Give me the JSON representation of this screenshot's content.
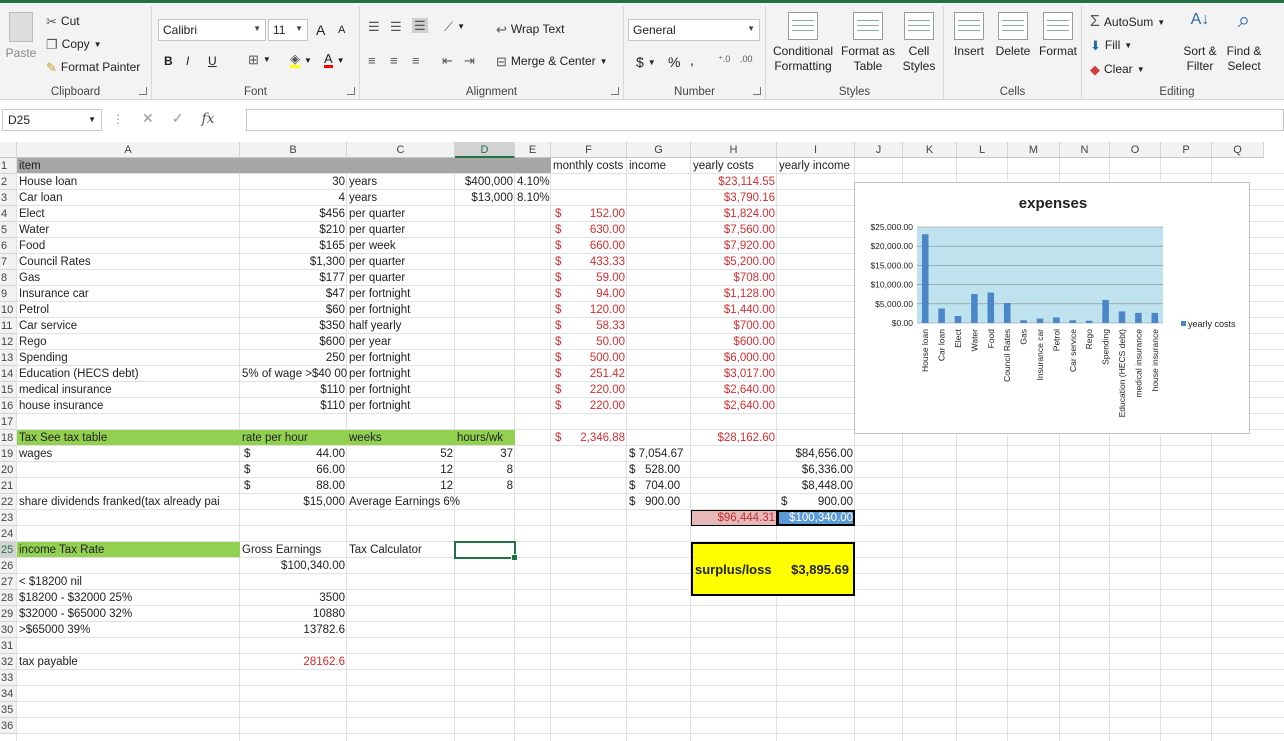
{
  "ribbon": {
    "clipboard": {
      "paste": "Paste",
      "cut": "Cut",
      "copy": "Copy",
      "format_painter": "Format Painter",
      "label": "Clipboard"
    },
    "font": {
      "name": "Calibri",
      "size": "11",
      "bold": "B",
      "italic": "I",
      "underline": "U",
      "grow": "A",
      "shrink": "A",
      "label": "Font"
    },
    "alignment": {
      "wrap": "Wrap Text",
      "merge": "Merge & Center",
      "label": "Alignment"
    },
    "number": {
      "format": "General",
      "currency": "$",
      "percent": "%",
      "comma": ",",
      "inc_decimal": ".00 →.0",
      "dec_decimal": ".00 →.0",
      "label": "Number"
    },
    "styles": {
      "conditional": "Conditional Formatting",
      "format_table": "Format as Table",
      "cell_styles": "Cell Styles",
      "label": "Styles"
    },
    "cells": {
      "insert": "Insert",
      "delete": "Delete",
      "format": "Format",
      "label": "Cells"
    },
    "editing": {
      "autosum": "AutoSum",
      "fill": "Fill",
      "clear": "Clear",
      "sort": "Sort & Filter",
      "find": "Find & Select",
      "label": "Editing"
    }
  },
  "formula_bar": {
    "name_box": "D25",
    "fx": "fx",
    "value": ""
  },
  "columns": [
    "A",
    "B",
    "C",
    "D",
    "E",
    "F",
    "G",
    "H",
    "I",
    "J",
    "K",
    "L",
    "M",
    "N",
    "O",
    "P",
    "Q"
  ],
  "rows": [
    "1",
    "2",
    "3",
    "4",
    "5",
    "6",
    "7",
    "8",
    "9",
    "10",
    "11",
    "12",
    "13",
    "14",
    "15",
    "16",
    "17",
    "18",
    "19",
    "20",
    "21",
    "22",
    "23",
    "24",
    "25",
    "26",
    "27",
    "28",
    "29",
    "30",
    "31",
    "32",
    "33",
    "34",
    "35",
    "36"
  ],
  "cells": {
    "A1": "item",
    "F1": "monthly costs",
    "G1": "income",
    "H1": "yearly costs",
    "I1": "yearly income",
    "A2": "House loan",
    "B2": "30",
    "C2": "years",
    "D2": "$400,000",
    "E2": "4.10%",
    "F2": "$1,926.21",
    "H2": "$23,114.55",
    "A3": "Car loan",
    "B3": "4",
    "C3": "years",
    "D3": "$13,000",
    "E3": "8.10%",
    "F3s": "$",
    "F3": "315.85",
    "H3": "$3,790.16",
    "A4": "Elect",
    "B4": "$456",
    "C4": "per quarter",
    "F4s": "$",
    "F4": "152.00",
    "H4": "$1,824.00",
    "A5": "Water",
    "B5": "$210",
    "C5": "per quarter",
    "F5s": "$",
    "F5": "630.00",
    "H5": "$7,560.00",
    "A6": "Food",
    "B6": "$165",
    "C6": "per week",
    "F6s": "$",
    "F6": "660.00",
    "H6": "$7,920.00",
    "A7": "Council Rates",
    "B7": "$1,300",
    "C7": "per quarter",
    "F7s": "$",
    "F7": "433.33",
    "H7": "$5,200.00",
    "A8": "Gas",
    "B8": "$177",
    "C8": "per quarter",
    "F8s": "$",
    "F8": "59.00",
    "H8": "$708.00",
    "A9": "Insurance car",
    "B9": "$47",
    "C9": "per fortnight",
    "F9s": "$",
    "F9": "94.00",
    "H9": "$1,128.00",
    "A10": "Petrol",
    "B10": "$60",
    "C10": "per fortnight",
    "F10s": "$",
    "F10": "120.00",
    "H10": "$1,440.00",
    "A11": "Car service",
    "B11": "$350",
    "C11": "half yearly",
    "F11s": "$",
    "F11": "58.33",
    "H11": "$700.00",
    "A12": "Rego",
    "B12": "$600",
    "C12": "per year",
    "F12s": "$",
    "F12": "50.00",
    "H12": "$600.00",
    "A13": "Spending",
    "B13": "250",
    "C13": "per fortnight",
    "F13s": "$",
    "F13": "500.00",
    "H13": "$6,000.00",
    "A14": "Education (HECS debt)",
    "B14": "5% of wage >$40 00",
    "C14": "per fortnight",
    "F14s": "$",
    "F14": "251.42",
    "H14": "$3,017.00",
    "A15": "medical insurance",
    "B15": "$110",
    "C15": "per fortnight",
    "F15s": "$",
    "F15": "220.00",
    "H15": "$2,640.00",
    "A16": "house insurance",
    "B16": "$110",
    "C16": "per fortnight",
    "F16s": "$",
    "F16": "220.00",
    "H16": "$2,640.00",
    "A18": "Tax See tax table",
    "B18": "rate per hour",
    "C18": "weeks",
    "D18": "hours/wk",
    "F18s": "$",
    "F18": "2,346.88",
    "H18": "$28,162.60",
    "A19": "wages",
    "B19s": "$",
    "B19": "44.00",
    "C19": "52",
    "D19": "37",
    "G19": "$ 7,054.67",
    "I19": "$84,656.00",
    "B20s": "$",
    "B20": "66.00",
    "C20": "12",
    "D20": "8",
    "G20": "$   528.00",
    "I20": "$6,336.00",
    "B21s": "$",
    "B21": "88.00",
    "C21": "12",
    "D21": "8",
    "G21": "$   704.00",
    "I21": "$8,448.00",
    "A22": "share dividends franked(tax already pai",
    "B22": "$15,000",
    "C22": "Average Earnings 6%",
    "G22": "$   900.00",
    "I22s": "$",
    "I22": "900.00",
    "H23": "$96,444.31",
    "I23": "$100,340.00",
    "A25": "income Tax Rate",
    "B25": "Gross Earnings",
    "C25": "Tax Calculator",
    "B26": "$100,340.00",
    "A27": "< $18200 nil",
    "A28": "$18200 - $32000 25%",
    "B28": "3500",
    "A29": "$32000 - $65000 32%",
    "B29": "10880",
    "A30": ">$65000 39%",
    "B30": "13782.6",
    "A32": "tax payable",
    "B32": "28162.6",
    "H25": "surplus/loss",
    "I25": "$3,895.69"
  },
  "chart_data": {
    "type": "bar",
    "title": "expenses",
    "categories": [
      "House loan",
      "Car loan",
      "Elect",
      "Water",
      "Food",
      "Council Rates",
      "Gas",
      "Insurance car",
      "Petrol",
      "Car service",
      "Rego",
      "Spending",
      "Education (HECS debt)",
      "medical insurance",
      "house insurance"
    ],
    "series": [
      {
        "name": "yearly costs",
        "values": [
          23114.55,
          3790.16,
          1824,
          7560,
          7920,
          5200,
          708,
          1128,
          1440,
          700,
          600,
          6000,
          3017,
          2640,
          2640
        ]
      }
    ],
    "yticks": [
      "$25,000.00",
      "$20,000.00",
      "$15,000.00",
      "$10,000.00",
      "$5,000.00",
      "$0.00"
    ],
    "ylim": [
      0,
      25000
    ],
    "legend": "right",
    "plot_bg": "#bfe3ee",
    "bar_color": "#4a86c8"
  }
}
